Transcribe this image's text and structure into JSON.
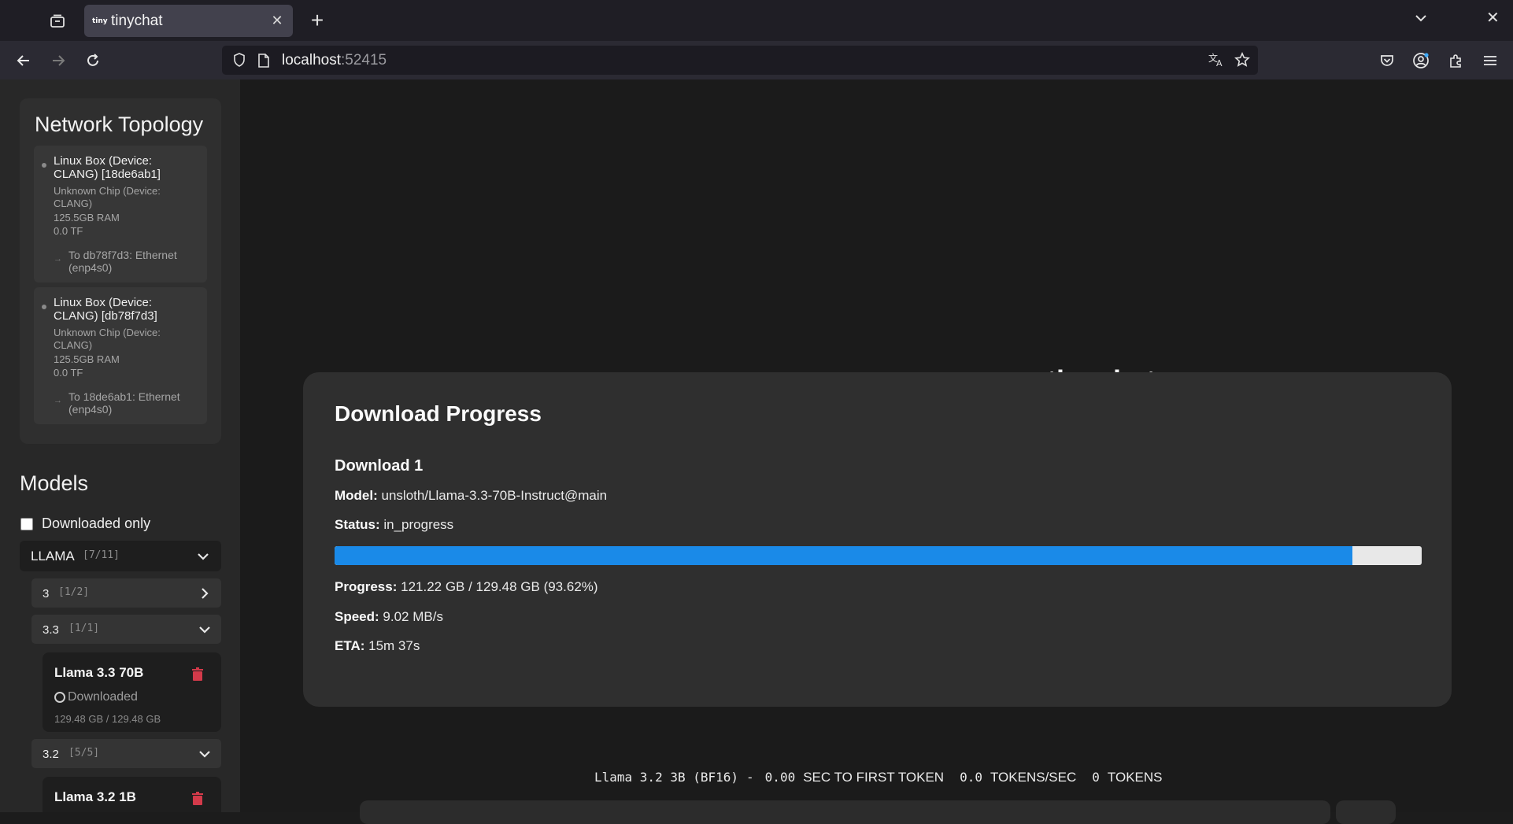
{
  "browser": {
    "tab_title": "tinychat",
    "tab_favicon_text": "tiny",
    "url_host": "localhost",
    "url_port": ":52415"
  },
  "topology": {
    "title": "Network Topology",
    "nodes": [
      {
        "name": "Linux Box (Device: CLANG) [18de6ab1]",
        "chip": "Unknown Chip (Device: CLANG)",
        "ram": "125.5GB RAM",
        "tflops": "0.0 TF",
        "connection": "To db78f7d3: Ethernet (enp4s0)"
      },
      {
        "name": "Linux Box (Device: CLANG) [db78f7d3]",
        "chip": "Unknown Chip (Device: CLANG)",
        "ram": "125.5GB RAM",
        "tflops": "0.0 TF",
        "connection": "To 18de6ab1: Ethernet (enp4s0)"
      }
    ]
  },
  "models": {
    "title": "Models",
    "downloaded_only_label": "Downloaded only",
    "downloaded_only_checked": false,
    "group": {
      "name": "LLAMA",
      "count": "[7/11]"
    },
    "subgroups": [
      {
        "name": "3",
        "count": "[1/2]",
        "expanded": false
      },
      {
        "name": "3.3",
        "count": "[1/1]",
        "expanded": true
      },
      {
        "name": "3.2",
        "count": "[5/5]",
        "expanded": true
      }
    ],
    "cards": [
      {
        "name": "Llama 3.3 70B",
        "status": "Downloaded",
        "size": "129.48 GB / 129.48 GB"
      },
      {
        "name": "Llama 3.2 1B"
      }
    ]
  },
  "ghost_title": "tinychat",
  "download_modal": {
    "title": "Download Progress",
    "item_title": "Download 1",
    "model_label": "Model:",
    "model_value": "unsloth/Llama-3.3-70B-Instruct@main",
    "status_label": "Status:",
    "status_value": "in_progress",
    "progress_fraction": 0.9362,
    "progress_label": "Progress:",
    "progress_value": "121.22 GB / 129.48 GB (93.62%)",
    "speed_label": "Speed:",
    "speed_value": "9.02 MB/s",
    "eta_label": "ETA:",
    "eta_value": "15m 37s"
  },
  "stats": {
    "model": "Llama 3.2 3B (BF16)",
    "sep": "-",
    "ttft_value": "0.00",
    "ttft_label": "SEC TO FIRST TOKEN",
    "tps_value": "0.0",
    "tps_label": "TOKENS/SEC",
    "tokens_value": "0",
    "tokens_label": "TOKENS"
  },
  "colors": {
    "progress": "#1a8ae8",
    "trash": "#d33a4a"
  }
}
